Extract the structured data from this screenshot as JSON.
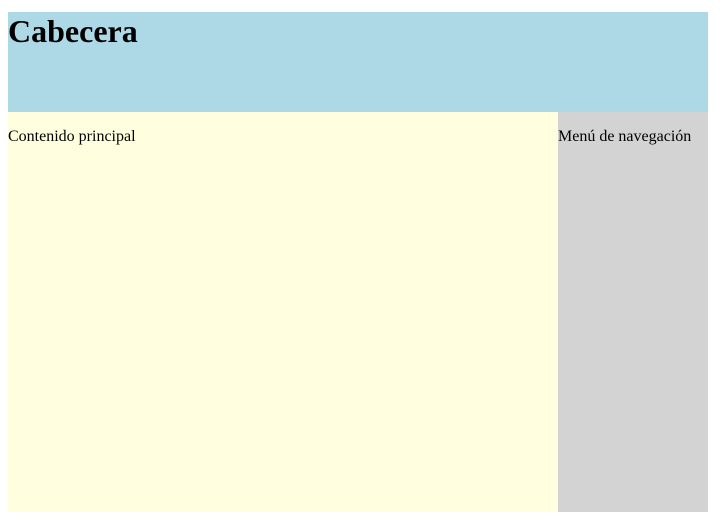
{
  "header": {
    "title": "Cabecera"
  },
  "main": {
    "text": "Contenido principal"
  },
  "nav": {
    "text": "Menú de navegación"
  },
  "colors": {
    "header_bg": "#add8e6",
    "main_bg": "#ffffe0",
    "nav_bg": "#d3d3d3",
    "text": "#000000"
  }
}
